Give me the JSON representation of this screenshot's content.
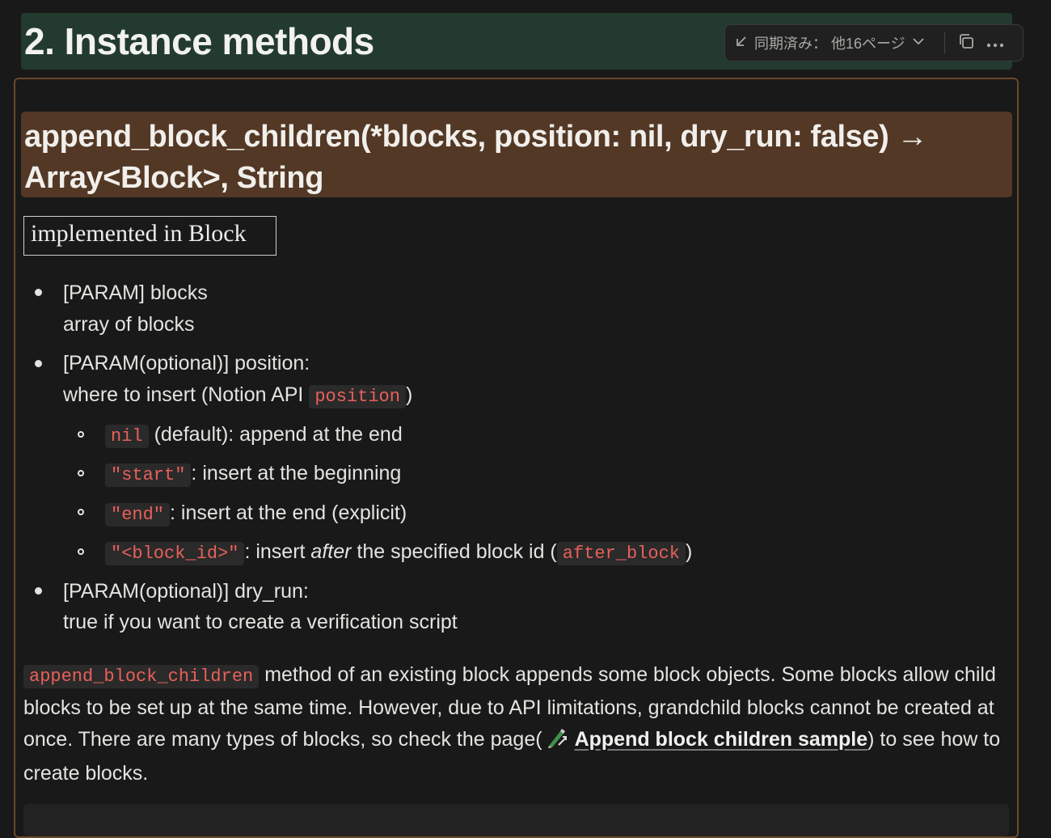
{
  "heading2": {
    "title": "2. Instance methods"
  },
  "sync_bar": {
    "label": "同期済み： 他16ページ",
    "icons": [
      "arrow-down-left-icon",
      "chevron-down-icon",
      "copy-icon",
      "more-icon"
    ]
  },
  "method": {
    "signature": "append_block_children(*blocks, position: nil, dry_run: false)   →  Array<Block>, String",
    "implemented": "implemented in Block"
  },
  "params": {
    "blocks_label": "[PARAM] blocks",
    "blocks_desc": "array of blocks",
    "position_label": "[PARAM(optional)] position:",
    "position_desc_prefix": "where to insert (Notion API",
    "position_code": "position",
    "position_desc_suffix": ")",
    "options": [
      {
        "code": "nil",
        "text": "(default): append at the end"
      },
      {
        "code": "\"start\"",
        "text": ": insert at the beginning"
      },
      {
        "code": "\"end\"",
        "text": ": insert at the end (explicit)"
      },
      {
        "code": "\"<block_id>\"",
        "text_pre": ": insert",
        "text_em": "after",
        "text_post": "the specified block id (",
        "code2": "after_block",
        "text_end": ")"
      }
    ],
    "dry_run_label": "[PARAM(optional)] dry_run:",
    "dry_run_desc": "true if you want to create a verification script"
  },
  "description": {
    "code": "append_block_children",
    "text1": "method of an existing block appends some block objects. Some blocks allow child blocks to be set up at the same time. However, due to API limitations, grandchild blocks cannot be created at once. There are many types of blocks, so check the page(",
    "link": "Append block children sample",
    "text2": ") to see how to create blocks."
  },
  "colors": {
    "heading2_bg": "#233a2f",
    "heading3_bg": "#533825",
    "code_red": "#e8605a",
    "synced_border": "#6b4a2a"
  }
}
